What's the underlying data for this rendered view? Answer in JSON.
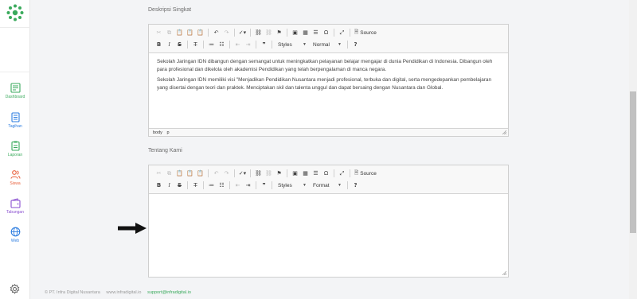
{
  "sidebar": {
    "items": [
      {
        "label": "Dashboard",
        "icon": "dashboard-icon",
        "color": "#3aaa5c"
      },
      {
        "label": "Tagihan",
        "icon": "invoice-icon",
        "color": "#2d7de0"
      },
      {
        "label": "Laporan",
        "icon": "report-icon",
        "color": "#3aaa5c"
      },
      {
        "label": "Siswa",
        "icon": "students-icon",
        "color": "#e8603c"
      },
      {
        "label": "Tabungan",
        "icon": "wallet-icon",
        "color": "#8a4fd0"
      },
      {
        "label": "Web",
        "icon": "globe-icon",
        "color": "#2d7de0"
      }
    ]
  },
  "sections": {
    "deskripsi": {
      "label": "Deskripsi Singkat",
      "paragraphs": [
        "Sekolah Jaringan IDN dibangun dengan semangat untuk meningkatkan pelayanan belajar mengajar di dunia Pendidikan di Indonesia. Dibangun oleh para profesional dan dikelola oleh akademisi Pendidikan yang telah berpengalaman di manca negara.",
        "Sekolah Jaringan IDN memiliki visi \"Menjadikan Pendidikan Nusantara menjadi profesional, terbuka dan digital, serta mengedepankan pembelajaran yang disertai dengan teori dan praktek. Menciptakan skil dan talenta unggul dan dapat bersaing dengan Nusantara dan Global."
      ],
      "path": [
        "body",
        "p"
      ]
    },
    "tentang": {
      "label": "Tentang Kami"
    }
  },
  "toolbar": {
    "source_label": "Source",
    "styles_label": "Styles",
    "normal_label": "Normal",
    "format_label": "Format",
    "bold": "B",
    "italic": "I",
    "strike": "S",
    "help": "?"
  },
  "footer": {
    "copyright": "© PT. Infra Digital Nusantara",
    "website": "www.infradigital.io",
    "email": "support@infradigital.io"
  },
  "colors": {
    "brand": "#3aaa5c"
  }
}
